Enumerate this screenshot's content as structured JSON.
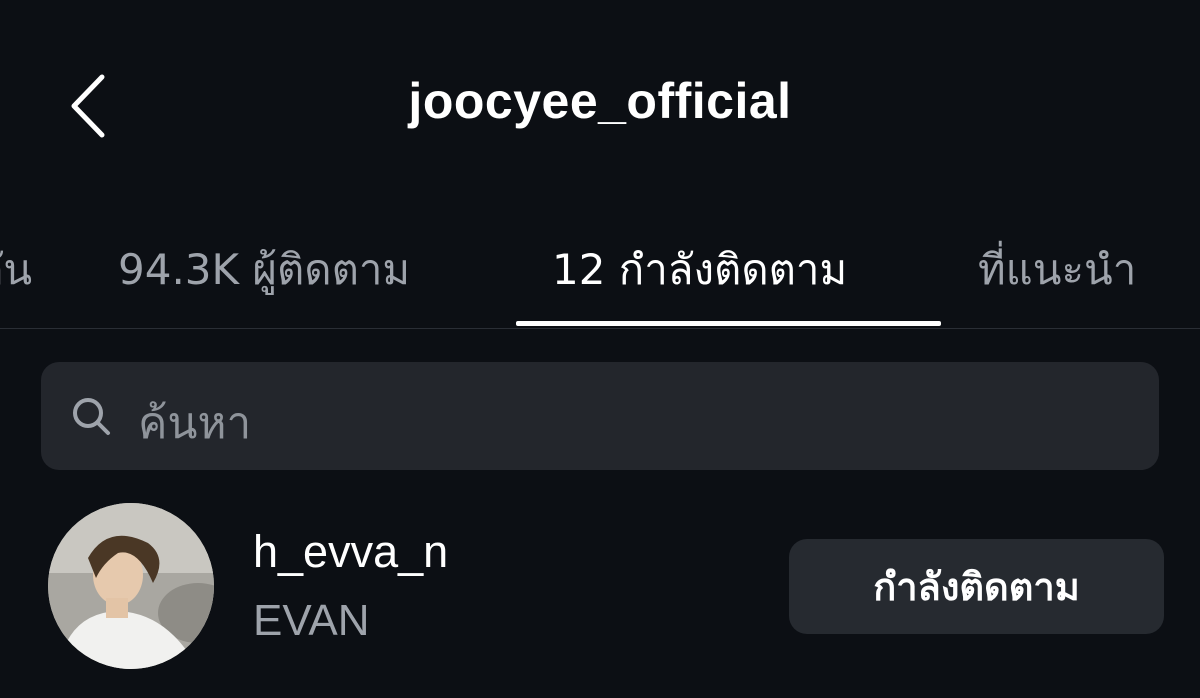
{
  "header": {
    "back_icon": "chevron-left-icon",
    "title": "joocyee_official"
  },
  "tabs": [
    {
      "label": "กัน",
      "active": false
    },
    {
      "label": "94.3K ผู้ติดตาม",
      "active": false
    },
    {
      "label": "12 กำลังติดตาม",
      "active": true
    },
    {
      "label": "ที่แนะนำ",
      "active": false
    }
  ],
  "search": {
    "icon": "search-icon",
    "placeholder": "ค้นหา"
  },
  "list": [
    {
      "username": "h_evva_n",
      "fullname": "EVAN",
      "button_label": "กำลังติดตาม"
    }
  ],
  "colors": {
    "background": "#0c0f14",
    "surface": "#23262c",
    "button": "#262a30",
    "text_primary": "#ffffff",
    "text_secondary": "#9ea3ab"
  }
}
